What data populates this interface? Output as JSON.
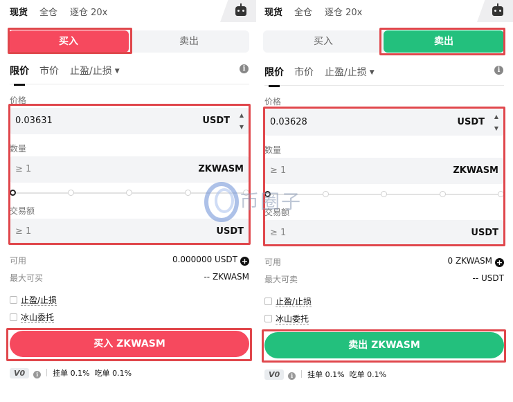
{
  "mode_tabs": [
    "现货",
    "全仓",
    "逐仓 20x"
  ],
  "left": {
    "side_buy": "买入",
    "side_sell": "卖出",
    "order_types": [
      "限价",
      "市价",
      "止盈/止损"
    ],
    "price_label": "价格",
    "price_value": "0.03631",
    "price_unit": "USDT",
    "qty_label": "数量",
    "qty_placeholder": "≥ 1",
    "qty_unit": "ZKWASM",
    "amount_label": "交易额",
    "amount_placeholder": "≥ 1",
    "amount_unit": "USDT",
    "available_label": "可用",
    "available_value": "0.000000 USDT",
    "max_label": "最大可买",
    "max_value": "-- ZKWASM",
    "tpsl_label": "止盈/止损",
    "iceberg_label": "冰山委托",
    "submit_label": "买入 ZKWASM",
    "vip_level": "V0",
    "maker_fee": "挂单 0.1%",
    "taker_fee": "吃单 0.1%"
  },
  "right": {
    "side_buy": "买入",
    "side_sell": "卖出",
    "order_types": [
      "限价",
      "市价",
      "止盈/止损"
    ],
    "price_label": "价格",
    "price_value": "0.03628",
    "price_unit": "USDT",
    "qty_label": "数量",
    "qty_placeholder": "≥ 1",
    "qty_unit": "ZKWASM",
    "amount_label": "交易额",
    "amount_placeholder": "≥ 1",
    "amount_unit": "USDT",
    "available_label": "可用",
    "available_value": "0 ZKWASM",
    "max_label": "最大可卖",
    "max_value": "-- USDT",
    "tpsl_label": "止盈/止损",
    "iceberg_label": "冰山委托",
    "submit_label": "卖出 ZKWASM",
    "vip_level": "V0",
    "maker_fee": "挂单 0.1%",
    "taker_fee": "吃单 0.1%"
  },
  "colors": {
    "buy": "#f6495e",
    "sell": "#23c07d",
    "highlight": "#e0474c"
  },
  "icons": [
    "robot-icon",
    "info-icon",
    "plus-icon",
    "caret-down-icon",
    "stepper-up-icon",
    "stepper-down-icon"
  ],
  "watermark": {
    "text": "币圈子"
  }
}
